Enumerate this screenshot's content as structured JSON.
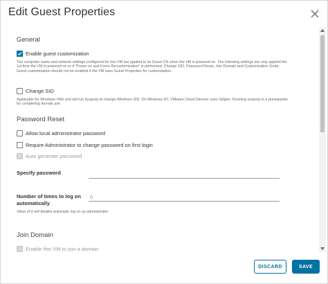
{
  "dialog": {
    "title": "Edit Guest Properties"
  },
  "general": {
    "heading": "General",
    "enable_customization": {
      "label": "Enable guest customization",
      "checked": true,
      "help": "The computer name and network settings configured for this VM are applied to its Guest OS when the VM is powered on. The following settings are only applied the 1st time the VM is powered on or if \"Power on and Force Recustomization\" is performed: Change SID, Password Reset, Join Domain and Customization Script. Guest customization should not be enabled if the VM uses Guest Properties for customization."
    },
    "change_sid": {
      "label": "Change SID",
      "checked": false,
      "help": "Applicable for Windows VMs and will run Sysprep to change Windows SID. On Windows NT, VMware Cloud Director uses Sidgen. Running sysprep is a prerequisite for completing domain join."
    }
  },
  "password_reset": {
    "heading": "Password Reset",
    "allow_local_admin": {
      "label": "Allow local administrator password",
      "checked": false
    },
    "require_admin_change": {
      "label": "Require Administrator to change password on first login",
      "checked": false
    },
    "auto_generate": {
      "label": "Auto generate password",
      "checked": false,
      "disabled": true
    },
    "specify_password": {
      "label": "Specify password",
      "value": ""
    },
    "logon_times": {
      "label": "Number of times to log on automatically",
      "placeholder": "0",
      "help": "Value of 0 will disable automatic log on as administrator."
    }
  },
  "join_domain": {
    "heading": "Join Domain",
    "enable_join": {
      "label": "Enable this VM to join a domain",
      "checked": false,
      "disabled": true
    }
  },
  "footer": {
    "discard_label": "DISCARD",
    "save_label": "SAVE"
  },
  "colors": {
    "accent": "#0072a3",
    "disabled": "#d8d8d8"
  }
}
